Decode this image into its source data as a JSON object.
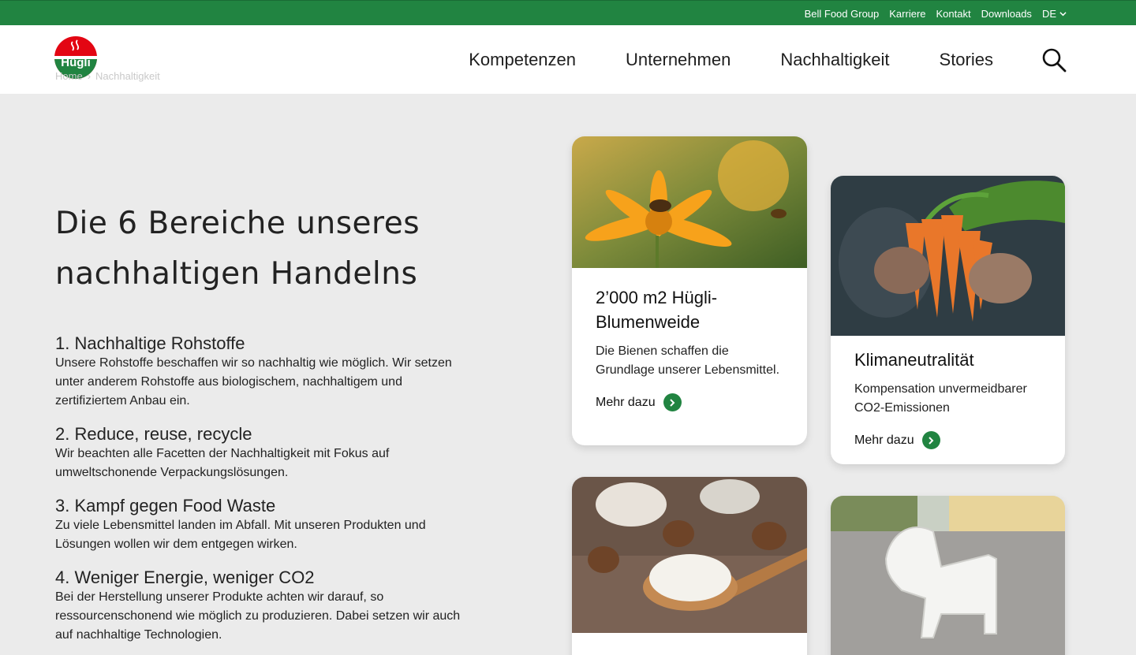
{
  "topbar": {
    "links": [
      "Bell Food Group",
      "Karriere",
      "Kontakt",
      "Downloads"
    ],
    "language": "DE",
    "color": "#218441"
  },
  "header": {
    "logo_text": "Hügli",
    "breadcrumb": [
      "Home",
      "Nachhaltigkeit"
    ],
    "nav": [
      "Kompetenzen",
      "Unternehmen",
      "Nachhaltigkeit",
      "Stories"
    ],
    "search_icon": "search-icon"
  },
  "main": {
    "headline": "Die 6 Bereiche unseres nachhaltigen Handelns",
    "items": [
      {
        "title": "1. Nachhaltige Rohstoffe",
        "text": "Unsere Rohstoffe beschaffen wir so nachhaltig wie möglich. Wir setzen unter anderem Rohstoffe aus biologischem, nachhaltigem und zertifiziertem Anbau ein."
      },
      {
        "title": "2. Reduce, reuse, recycle",
        "text": "Wir beachten alle Facetten der Nachhaltigkeit mit Fokus auf umweltschonende Verpackungslösungen."
      },
      {
        "title": "3. Kampf gegen Food Waste",
        "text": "Zu viele Lebensmittel landen im Abfall. Mit unseren Produkten und Lösungen wollen wir dem entgegen wirken."
      },
      {
        "title": "4. Weniger Energie, weniger CO2",
        "text": "Bei der Herstellung unserer Produkte achten wir darauf, so ressourcenschonend wie möglich zu produzieren. Dabei setzen wir auch auf nachhaltige Technologien."
      }
    ]
  },
  "cards": [
    {
      "title": "2’000 m2 Hügli-Blumenweide",
      "text": "Die Bienen schaffen die Grundlage unserer Lebensmittel.",
      "link": "Mehr dazu"
    },
    {
      "title": "Klimaneutralität",
      "text": "Kompensation unvermeidbarer CO2-Emissionen",
      "link": "Mehr dazu"
    }
  ]
}
